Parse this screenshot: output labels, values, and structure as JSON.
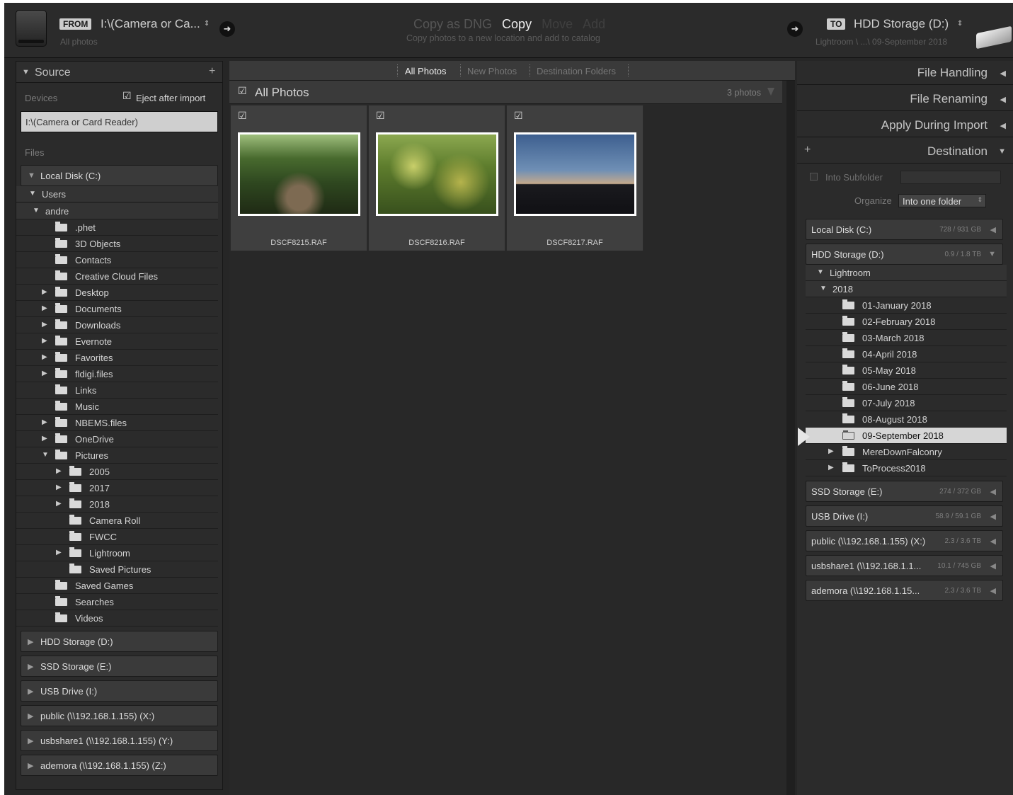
{
  "header": {
    "from_tag": "FROM",
    "source_name": "I:\\(Camera or Ca...",
    "source_sub": "All photos",
    "modes": [
      "Copy as DNG",
      "Copy",
      "Move",
      "Add"
    ],
    "mode_desc": "Copy photos to a new location and add to catalog",
    "to_tag": "TO",
    "dest_name": "HDD Storage (D:)",
    "dest_sub": "Lightroom \\ ...\\ 09-September 2018"
  },
  "left": {
    "source_title": "Source",
    "devices_label": "Devices",
    "eject_label": "Eject after import",
    "device_value": "I:\\(Camera or Card Reader)",
    "files_label": "Files",
    "local_disk": "Local Disk (C:)",
    "users": "Users",
    "andre": "andre",
    "folders": [
      {
        "name": ".phet",
        "expand": false,
        "level": 0
      },
      {
        "name": "3D Objects",
        "expand": false,
        "level": 0
      },
      {
        "name": "Contacts",
        "expand": false,
        "level": 0
      },
      {
        "name": "Creative Cloud Files",
        "expand": false,
        "level": 0
      },
      {
        "name": "Desktop",
        "expand": true,
        "level": 0
      },
      {
        "name": "Documents",
        "expand": true,
        "level": 0
      },
      {
        "name": "Downloads",
        "expand": true,
        "level": 0
      },
      {
        "name": "Evernote",
        "expand": true,
        "level": 0
      },
      {
        "name": "Favorites",
        "expand": true,
        "level": 0
      },
      {
        "name": "fldigi.files",
        "expand": true,
        "level": 0
      },
      {
        "name": "Links",
        "expand": false,
        "level": 0
      },
      {
        "name": "Music",
        "expand": false,
        "level": 0
      },
      {
        "name": "NBEMS.files",
        "expand": true,
        "level": 0
      },
      {
        "name": "OneDrive",
        "expand": true,
        "level": 0
      },
      {
        "name": "Pictures",
        "expand": true,
        "level": 0,
        "open": true
      },
      {
        "name": "2005",
        "expand": true,
        "level": 1
      },
      {
        "name": "2017",
        "expand": true,
        "level": 1
      },
      {
        "name": "2018",
        "expand": true,
        "level": 1
      },
      {
        "name": "Camera Roll",
        "expand": false,
        "level": 1
      },
      {
        "name": "FWCC",
        "expand": false,
        "level": 1
      },
      {
        "name": "Lightroom",
        "expand": true,
        "level": 1
      },
      {
        "name": "Saved Pictures",
        "expand": false,
        "level": 1
      },
      {
        "name": "Saved Games",
        "expand": false,
        "level": 0
      },
      {
        "name": "Searches",
        "expand": false,
        "level": 0
      },
      {
        "name": "Videos",
        "expand": false,
        "level": 0
      }
    ],
    "other_drives": [
      "HDD Storage (D:)",
      "SSD Storage (E:)",
      "USB Drive (I:)",
      "public (\\\\192.168.1.155) (X:)",
      "usbshare1 (\\\\192.168.1.155) (Y:)",
      "ademora (\\\\192.168.1.155) (Z:)"
    ]
  },
  "center": {
    "tabs": [
      "All Photos",
      "New Photos",
      "Destination Folders"
    ],
    "grid_title": "All Photos",
    "photo_count": "3 photos",
    "photos": [
      "DSCF8215.RAF",
      "DSCF8216.RAF",
      "DSCF8217.RAF"
    ]
  },
  "right": {
    "file_handling": "File Handling",
    "file_renaming": "File Renaming",
    "apply_during_import": "Apply During Import",
    "destination": "Destination",
    "into_subfolder": "Into Subfolder",
    "organize_label": "Organize",
    "organize_value": "Into one folder",
    "drive_local": {
      "name": "Local Disk (C:)",
      "size": "728 / 931 GB"
    },
    "drive_hdd": {
      "name": "HDD Storage (D:)",
      "size": "0.9 / 1.8 TB"
    },
    "lightroom": "Lightroom",
    "year": "2018",
    "months": [
      "01-January 2018",
      "02-February 2018",
      "03-March 2018",
      "04-April 2018",
      "05-May 2018",
      "06-June 2018",
      "07-July 2018",
      "08-August 2018",
      "09-September 2018"
    ],
    "other_folders": [
      "MereDownFalconry",
      "ToProcess2018"
    ],
    "drives_after": [
      {
        "name": "SSD Storage (E:)",
        "size": "274 / 372 GB"
      },
      {
        "name": "USB Drive (I:)",
        "size": "58.9 / 59.1 GB"
      },
      {
        "name": "public (\\\\192.168.1.155) (X:)",
        "size": "2.3 / 3.6 TB"
      },
      {
        "name": "usbshare1 (\\\\192.168.1.1...",
        "size": "10.1 / 745 GB"
      },
      {
        "name": "ademora (\\\\192.168.1.15...",
        "size": "2.3 / 3.6 TB"
      }
    ]
  }
}
